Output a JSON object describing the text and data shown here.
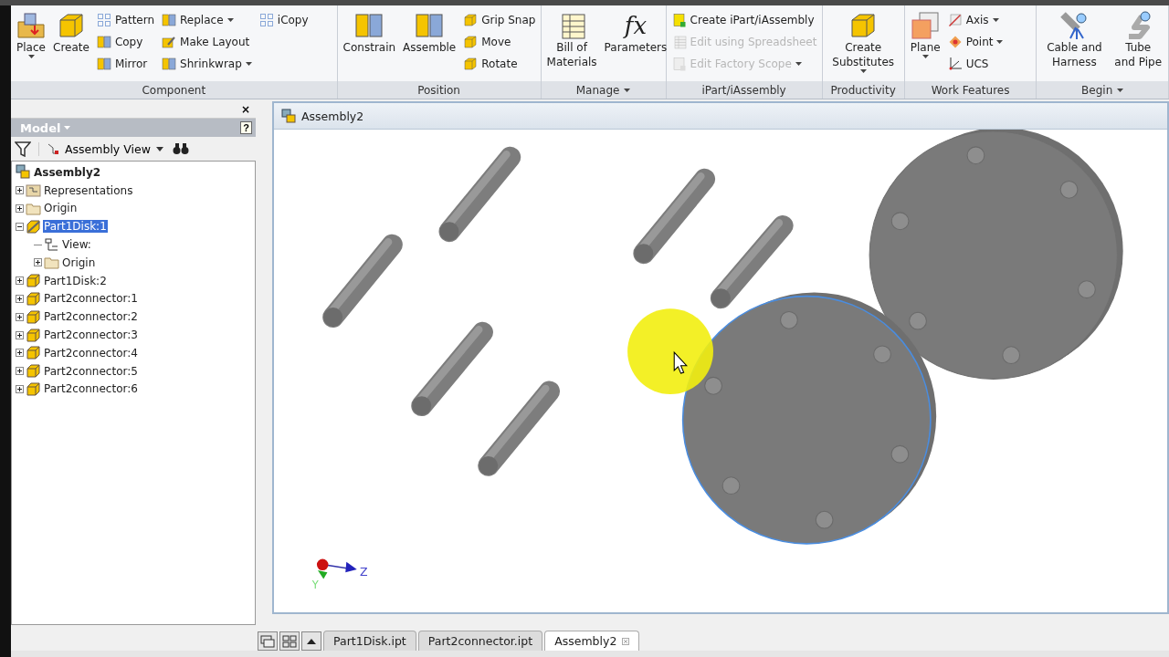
{
  "ribbon": {
    "groups": [
      {
        "label": "Component",
        "has_menu": false,
        "tools": [
          {
            "label": "Place",
            "kind": "large",
            "dropdown": true,
            "disabled": false
          },
          {
            "label": "Create",
            "kind": "large",
            "dropdown": false,
            "disabled": false
          },
          {
            "label": "Pattern",
            "kind": "small",
            "dropdown": false,
            "disabled": false
          },
          {
            "label": "Copy",
            "kind": "small",
            "dropdown": false,
            "disabled": false
          },
          {
            "label": "Mirror",
            "kind": "small",
            "dropdown": false,
            "disabled": false
          },
          {
            "label": "Replace",
            "kind": "small",
            "dropdown": true,
            "disabled": false
          },
          {
            "label": "Make Layout",
            "kind": "small",
            "dropdown": false,
            "disabled": false
          },
          {
            "label": "Shrinkwrap",
            "kind": "small",
            "dropdown": true,
            "disabled": false
          },
          {
            "label": "iCopy",
            "kind": "small",
            "dropdown": false,
            "disabled": false
          }
        ]
      },
      {
        "label": "Position",
        "has_menu": false,
        "tools": [
          {
            "label": "Constrain",
            "kind": "large",
            "dropdown": false,
            "disabled": false
          },
          {
            "label": "Assemble",
            "kind": "large",
            "dropdown": false,
            "disabled": false
          },
          {
            "label": "Grip Snap",
            "kind": "small",
            "dropdown": false,
            "disabled": false
          },
          {
            "label": "Move",
            "kind": "small",
            "dropdown": false,
            "disabled": false
          },
          {
            "label": "Rotate",
            "kind": "small",
            "dropdown": false,
            "disabled": false
          }
        ]
      },
      {
        "label": "Manage",
        "has_menu": true,
        "tools": [
          {
            "label": "Bill of Materials",
            "kind": "large",
            "dropdown": false,
            "disabled": false
          },
          {
            "label": "Parameters",
            "kind": "large",
            "glyph": "fx",
            "dropdown": false,
            "disabled": false
          }
        ]
      },
      {
        "label": "iPart/iAssembly",
        "has_menu": false,
        "tools": [
          {
            "label": "Create iPart/iAssembly",
            "kind": "small",
            "dropdown": false,
            "disabled": false
          },
          {
            "label": "Edit using Spreadsheet",
            "kind": "small",
            "dropdown": false,
            "disabled": true
          },
          {
            "label": "Edit Factory Scope",
            "kind": "small",
            "dropdown": true,
            "disabled": true
          }
        ]
      },
      {
        "label": "Productivity",
        "has_menu": false,
        "tools": [
          {
            "label": "Create Substitutes",
            "kind": "large",
            "dropdown": true,
            "disabled": false
          }
        ]
      },
      {
        "label": "Work Features",
        "has_menu": false,
        "tools": [
          {
            "label": "Plane",
            "kind": "large",
            "dropdown": true,
            "disabled": false
          },
          {
            "label": "Axis",
            "kind": "small",
            "dropdown": true,
            "disabled": false
          },
          {
            "label": "Point",
            "kind": "small",
            "dropdown": true,
            "disabled": false
          },
          {
            "label": "UCS",
            "kind": "small",
            "dropdown": false,
            "disabled": false
          }
        ]
      },
      {
        "label": "Begin",
        "has_menu": true,
        "tools": [
          {
            "label": "Cable and Harness",
            "kind": "large",
            "dropdown": false,
            "disabled": false
          },
          {
            "label": "Tube and Pipe",
            "kind": "large",
            "dropdown": false,
            "disabled": false
          }
        ]
      }
    ]
  },
  "browser": {
    "close": "×",
    "title": "Model",
    "help": "?",
    "view": "Assembly View",
    "tree": [
      {
        "label": "Assembly2",
        "kind": "assembly",
        "selected": false,
        "children": [
          {
            "label": "Representations",
            "kind": "representations",
            "selected": false,
            "expanded": false
          },
          {
            "label": "Origin",
            "kind": "folder",
            "selected": false,
            "expanded": false
          },
          {
            "label": "Part1Disk:1",
            "kind": "active-part",
            "selected": true,
            "expanded": true,
            "children": [
              {
                "label": "View:",
                "kind": "view",
                "selected": false
              },
              {
                "label": "Origin",
                "kind": "folder",
                "selected": false,
                "expanded": false
              }
            ]
          },
          {
            "label": "Part1Disk:2",
            "kind": "part",
            "selected": false,
            "expanded": false
          },
          {
            "label": "Part2connector:1",
            "kind": "part",
            "selected": false,
            "expanded": false
          },
          {
            "label": "Part2connector:2",
            "kind": "part",
            "selected": false,
            "expanded": false
          },
          {
            "label": "Part2connector:3",
            "kind": "part",
            "selected": false,
            "expanded": false
          },
          {
            "label": "Part2connector:4",
            "kind": "part",
            "selected": false,
            "expanded": false
          },
          {
            "label": "Part2connector:5",
            "kind": "part",
            "selected": false,
            "expanded": false
          },
          {
            "label": "Part2connector:6",
            "kind": "part",
            "selected": false,
            "expanded": false
          }
        ]
      }
    ]
  },
  "viewport": {
    "title": "Assembly2",
    "scene": [
      {
        "kind": "rod"
      },
      {
        "kind": "rod"
      },
      {
        "kind": "rod"
      },
      {
        "kind": "rod"
      },
      {
        "kind": "rod"
      },
      {
        "kind": "rod"
      },
      {
        "kind": "disk",
        "selected": false
      },
      {
        "kind": "disk",
        "selected": true
      }
    ],
    "triad": {
      "z_label": "Z",
      "y_label": "Y"
    }
  },
  "document_tabs": [
    {
      "label": "Part1Disk.ipt",
      "selected": false
    },
    {
      "label": "Part2connector.ipt",
      "selected": false
    },
    {
      "label": "Assembly2",
      "selected": true
    }
  ]
}
